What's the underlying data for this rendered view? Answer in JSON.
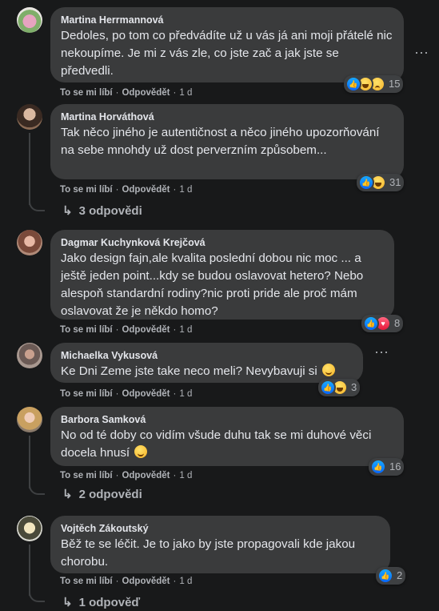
{
  "comments": [
    {
      "author": "Martina Herrmannová",
      "text": "Dedoles, po tom co předvádíte už u vás já ani moji přátelé nic nekoupíme. Je mi z vás zle, co jste zač a jak jste se předvedli.",
      "like_label": "To se mi líbí",
      "reply_label": "Odpovědět",
      "time": "1 d",
      "reaction_count": "15"
    },
    {
      "author": "Martina Horváthová",
      "text": "Tak něco jiného je autentičnost a něco jiného upozorňování na sebe mnohdy už dost perverzním způsobem...",
      "like_label": "To se mi líbí",
      "reply_label": "Odpovědět",
      "time": "1 d",
      "reaction_count": "31",
      "replies_label": "3 odpovědi"
    },
    {
      "author": "Dagmar Kuchynková Krejčová",
      "text": "Jako design fajn,ale kvalita poslední dobou nic moc ... a ještě jeden point...kdy se budou oslavovat hetero? Nebo alespoň standardní rodiny?nic proti pride ale proč mám oslavovat že je někdo homo?",
      "like_label": "To se mi líbí",
      "reply_label": "Odpovědět",
      "time": "1 d",
      "reaction_count": "8"
    },
    {
      "author": "Michaelka Vykusová",
      "text": "Ke Dni Zeme jste take neco meli? Nevybavuji si",
      "like_label": "To se mi líbí",
      "reply_label": "Odpovědět",
      "time": "1 d",
      "reaction_count": "3"
    },
    {
      "author": "Barbora Samková",
      "text": "No od té doby co vidím všude duhu tak se mi duhové věci docela hnusí",
      "like_label": "To se mi líbí",
      "reply_label": "Odpovědět",
      "time": "1 d",
      "reaction_count": "16",
      "replies_label": "2 odpovědi"
    },
    {
      "author": "Vojtěch Zákoutský",
      "text": "Běž te se léčit. Je to jako by jste propagovali kde jakou chorobu.",
      "like_label": "To se mi líbí",
      "reply_label": "Odpovědět",
      "time": "1 d",
      "reaction_count": "2",
      "replies_label": "1 odpověď"
    }
  ],
  "icons": {
    "more": "more-horizontal-icon",
    "like": "like-reaction-icon",
    "haha": "haha-reaction-icon",
    "sad": "sad-reaction-icon",
    "love": "love-reaction-icon",
    "reply_arrow": "reply-arrow-icon"
  },
  "colors": {
    "background": "#18191a",
    "bubble": "#3a3b3c",
    "text": "#e4e6eb",
    "secondary_text": "#b0b3b8",
    "like_blue": "#0866ff"
  }
}
